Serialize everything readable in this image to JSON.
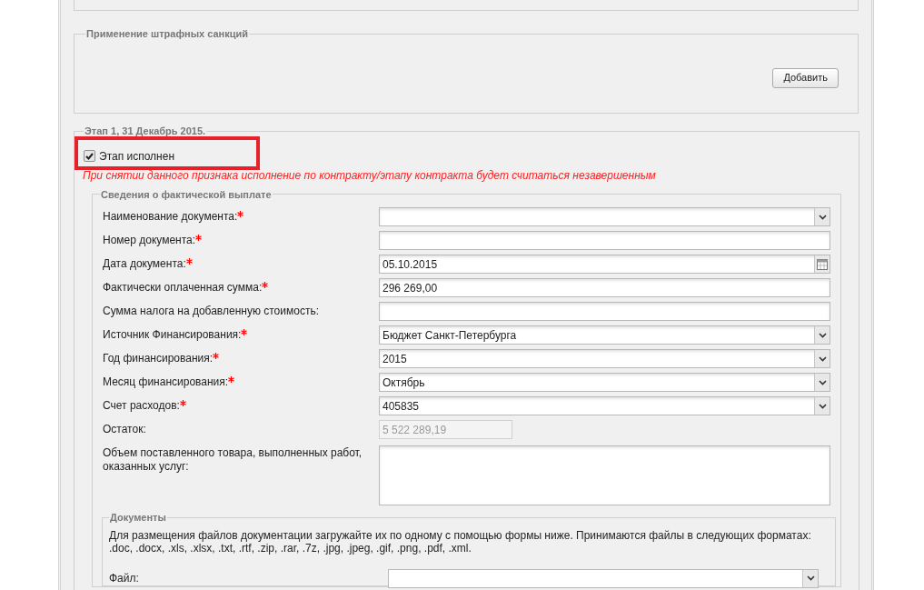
{
  "penalties": {
    "legend": "Применение штрафных санкций",
    "add_button": "Добавить"
  },
  "stage": {
    "legend": "Этап 1, 31 Декабрь 2015.",
    "completed": {
      "label": "Этап исполнен",
      "checked": true
    },
    "warning": "При снятии данного признака исполнение по контракту/этапу контракта будет считаться незавершенным",
    "payment": {
      "legend": "Сведения о фактической выплате",
      "fields": [
        {
          "kind": "select",
          "label": "Наименование документа:",
          "required": true
        },
        {
          "kind": "text",
          "label": "Номер документа:",
          "required": true
        },
        {
          "kind": "date",
          "label": "Дата документа:",
          "required": true,
          "value": "05.10.2015"
        },
        {
          "kind": "text",
          "label": "Фактически оплаченная сумма:",
          "required": true,
          "value": "296 269,00"
        },
        {
          "kind": "text",
          "label": "Сумма налога на добавленную стоимость:",
          "required": false
        },
        {
          "kind": "select",
          "label": "Источник Финансирования:",
          "required": true,
          "value": "Бюджет Санкт-Петербурга"
        },
        {
          "kind": "select",
          "label": "Год финансирования:",
          "required": true,
          "value": "2015"
        },
        {
          "kind": "select",
          "label": "Месяц финансирования:",
          "required": true,
          "value": "Октябрь"
        },
        {
          "kind": "select",
          "label": "Счет расходов:",
          "required": true,
          "value": "405835"
        },
        {
          "kind": "readonly",
          "label": "Остаток:",
          "required": false,
          "value": "5 522 289,19"
        },
        {
          "kind": "textarea",
          "label": "Объем поставленного товара, выполненных работ, оказанных услуг:",
          "required": false
        }
      ],
      "documents": {
        "legend": "Документы",
        "hint": "Для размещения файлов документации загружайте их по одному с помощью формы ниже. Принимаются файлы в следующих форматах: .doc, .docx, .xls, .xlsx, .txt, .rtf, .zip, .rar, .7z, .jpg, .jpeg, .gif, .png, .pdf, .xml.",
        "file_label": "Файл:"
      }
    }
  }
}
